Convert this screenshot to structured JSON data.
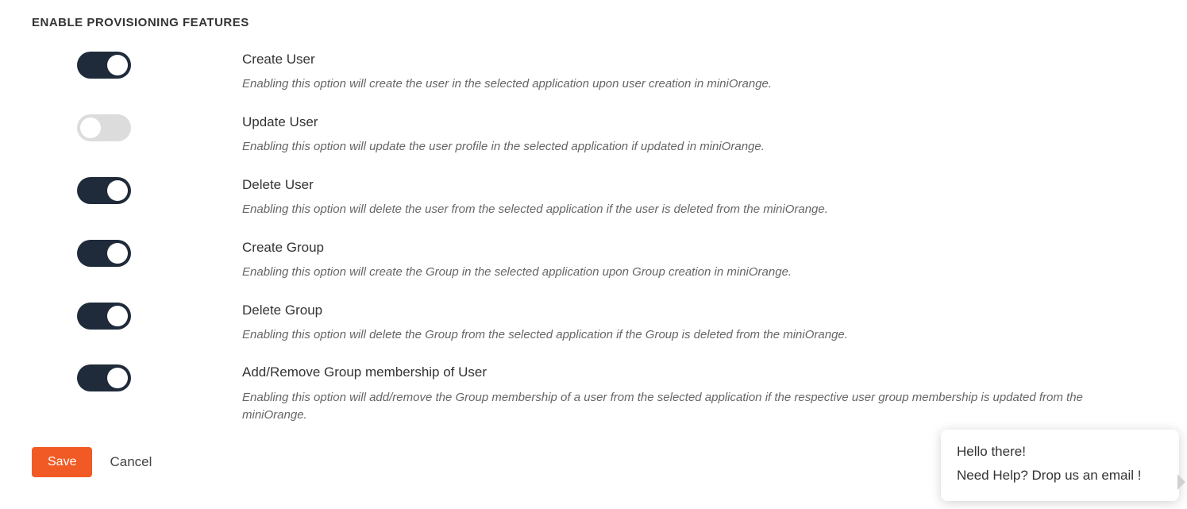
{
  "section_title": "ENABLE PROVISIONING FEATURES",
  "features": [
    {
      "enabled": true,
      "title": "Create User",
      "description": "Enabling this option will create the user in the selected application upon user creation in miniOrange."
    },
    {
      "enabled": false,
      "title": "Update User",
      "description": "Enabling this option will update the user profile in the selected application if updated in miniOrange."
    },
    {
      "enabled": true,
      "title": "Delete User",
      "description": "Enabling this option will delete the user from the selected application if the user is deleted from the miniOrange."
    },
    {
      "enabled": true,
      "title": "Create Group",
      "description": "Enabling this option will create the Group in the selected application upon Group creation in miniOrange."
    },
    {
      "enabled": true,
      "title": "Delete Group",
      "description": "Enabling this option will delete the Group from the selected application if the Group is deleted from the miniOrange."
    },
    {
      "enabled": true,
      "title": "Add/Remove Group membership of User",
      "description": "Enabling this option will add/remove the Group membership of a user from the selected application if the respective user group membership is updated from the miniOrange."
    }
  ],
  "buttons": {
    "save": "Save",
    "cancel": "Cancel"
  },
  "chat": {
    "line1": "Hello there!",
    "line2": "Need Help? Drop us an email !"
  }
}
